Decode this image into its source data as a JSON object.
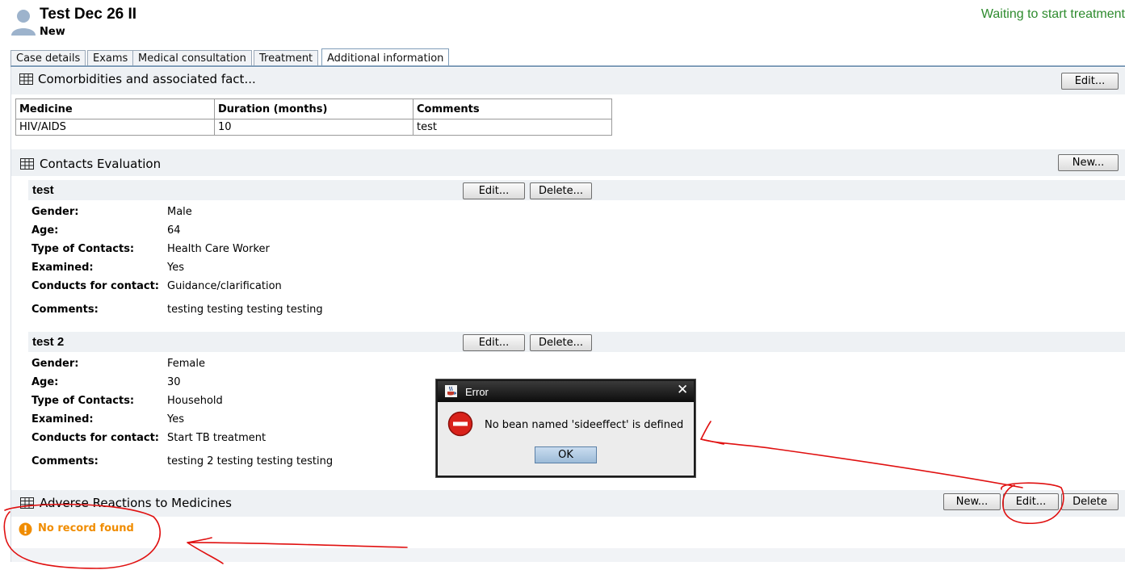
{
  "header": {
    "title": "Test Dec 26 II",
    "status": "New",
    "treatment_status": "Waiting to start treatment"
  },
  "tabs": [
    {
      "label": "Case details"
    },
    {
      "label": "Exams"
    },
    {
      "label": "Medical consultation"
    },
    {
      "label": "Treatment"
    },
    {
      "label": "Additional information",
      "active": true
    }
  ],
  "comorbidities": {
    "title": "Comorbidities and associated fact...",
    "edit_label": "Edit...",
    "columns": [
      "Medicine",
      "Duration (months)",
      "Comments"
    ],
    "rows": [
      [
        "HIV/AIDS",
        "10",
        "test"
      ]
    ]
  },
  "contacts": {
    "title": "Contacts Evaluation",
    "new_label": "New...",
    "edit_label": "Edit...",
    "delete_label": "Delete...",
    "labels": {
      "gender": "Gender:",
      "age": "Age:",
      "type": "Type of Contacts:",
      "examined": "Examined:",
      "conducts": "Conducts for contact:",
      "comments": "Comments:"
    },
    "items": [
      {
        "name": "test",
        "gender": "Male",
        "age": "64",
        "type": "Health Care Worker",
        "examined": "Yes",
        "conducts": "Guidance/clarification",
        "comments": "testing testing testing testing"
      },
      {
        "name": "test 2",
        "gender": "Female",
        "age": "30",
        "type": "Household",
        "examined": "Yes",
        "conducts": "Start TB treatment",
        "comments": "testing 2 testing testing testing"
      }
    ]
  },
  "adverse": {
    "title": "Adverse Reactions to Medicines",
    "new_label": "New...",
    "edit_label": "Edit...",
    "delete_label": "Delete",
    "empty_message": "No record found"
  },
  "dialog": {
    "title": "Error",
    "message": "No bean named 'sideeffect' is defined",
    "ok_label": "OK",
    "close_glyph": "✕"
  },
  "colors": {
    "treatment_status": "#2e8b2e",
    "warning": "#f08c00",
    "annotation": "#e01010"
  }
}
